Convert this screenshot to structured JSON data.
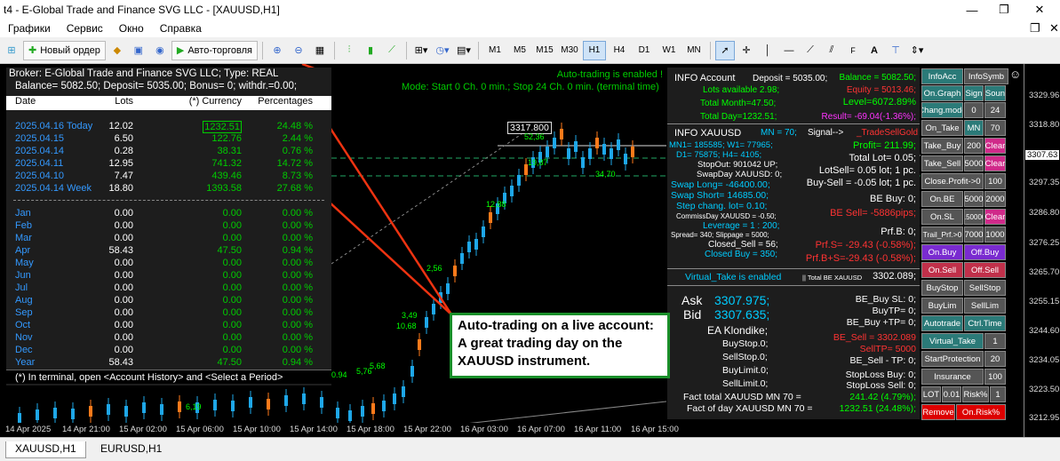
{
  "window": {
    "title": "t4 - E-Global Trade and Finance SVG LLC - [XAUUSD,H1]"
  },
  "menu": [
    "Графики",
    "Сервис",
    "Окно",
    "Справка"
  ],
  "toolbar": {
    "new_order": "Новый ордер",
    "autotrading": "Авто-торговля",
    "timeframes": [
      "M1",
      "M5",
      "M15",
      "M30",
      "H1",
      "H4",
      "D1",
      "W1",
      "MN"
    ],
    "selected_tf": "H1"
  },
  "left_panel": {
    "broker_line": "Broker:  E-Global Trade and Finance SVG LLC;   Type: REAL",
    "balance_line": "Balance= 5082.50; Deposit= 5035.00; Bonus= 0; withdr.=0.00;",
    "headers": {
      "date": "Date",
      "lots": "Lots",
      "currency": "(*)  Currency",
      "percent": "Percentages"
    },
    "days": [
      {
        "date": "2025.04.16 Today",
        "lots": "12.02",
        "currency": "1232.51",
        "percent": "24.48 %"
      },
      {
        "date": "2025.04.15",
        "lots": "6.50",
        "currency": "122.76",
        "percent": "2.44 %"
      },
      {
        "date": "2025.04.14",
        "lots": "0.28",
        "currency": "38.31",
        "percent": "0.76 %"
      },
      {
        "date": "2025.04.11",
        "lots": "12.95",
        "currency": "741.32",
        "percent": "14.72 %"
      },
      {
        "date": "2025.04.10",
        "lots": "7.47",
        "currency": "439.46",
        "percent": "8.73 %"
      },
      {
        "date": "2025.04.14 Week",
        "lots": "18.80",
        "currency": "1393.58",
        "percent": "27.68 %"
      }
    ],
    "months": [
      {
        "m": "Jan",
        "lots": "0.00",
        "currency": "0.00",
        "percent": "0.00 %"
      },
      {
        "m": "Feb",
        "lots": "0.00",
        "currency": "0.00",
        "percent": "0.00 %"
      },
      {
        "m": "Mar",
        "lots": "0.00",
        "currency": "0.00",
        "percent": "0.00 %"
      },
      {
        "m": "Apr",
        "lots": "58.43",
        "currency": "47.50",
        "percent": "0.94 %"
      },
      {
        "m": "May",
        "lots": "0.00",
        "currency": "0.00",
        "percent": "0.00 %"
      },
      {
        "m": "Jun",
        "lots": "0.00",
        "currency": "0.00",
        "percent": "0.00 %"
      },
      {
        "m": "Jul",
        "lots": "0.00",
        "currency": "0.00",
        "percent": "0.00 %"
      },
      {
        "m": "Aug",
        "lots": "0.00",
        "currency": "0.00",
        "percent": "0.00 %"
      },
      {
        "m": "Sep",
        "lots": "0.00",
        "currency": "0.00",
        "percent": "0.00 %"
      },
      {
        "m": "Oct",
        "lots": "0.00",
        "currency": "0.00",
        "percent": "0.00 %"
      },
      {
        "m": "Nov",
        "lots": "0.00",
        "currency": "0.00",
        "percent": "0.00 %"
      },
      {
        "m": "Dec",
        "lots": "0.00",
        "currency": "0.00",
        "percent": "0.00 %"
      },
      {
        "m": "Year",
        "lots": "58.43",
        "currency": "47.50",
        "percent": "0.94 %"
      }
    ],
    "footer": "(*) In terminal, open <Account History> and <Select a Period>"
  },
  "autotrading": {
    "enabled": "Auto-trading is enabled !",
    "mode": "Mode: Start  0 Ch. 0 min.;  Stop  24 Ch. 0 min. (terminal time)"
  },
  "chart": {
    "price_label": "3317.800",
    "current_price": "3307.63",
    "labels": [
      "52,36",
      "34,70",
      "19,87",
      "0.94",
      "3,49",
      "10,68",
      "5,76",
      "6,19",
      "5,68",
      "2,56",
      "12,88"
    ]
  },
  "info_account": {
    "title": "INFO Account",
    "deposit": "Deposit = 5035.00;",
    "balance": "Balance = 5082.50;",
    "lots_available": "Lots available 2.98;",
    "equity": "Equity = 5013.46;",
    "total_month": "Total Month=47.50;",
    "level": "Level=6072.89%",
    "total_day": "Total Day=1232.51;",
    "result": "Result= -69.04(-1.36%);"
  },
  "info_symbol": {
    "title": "INFO XAUUSD",
    "mn": "MN = 70;",
    "signal": "Signal-->",
    "ea": "_TradeSellGold",
    "l1": "MN1= 185585;  W1= 77965;",
    "l2": "D1= 75875;    H4= 4105;",
    "stopout": "StopOut: 901042 UP;",
    "swapday": "SwapDay XAUUSD:  0;",
    "swap_long": "Swap Long= -46400.00;",
    "swap_short": "Swap Short= 14685.00;",
    "step": "Step chang. lot= 0.10;",
    "commis": "CommissDay XAUUSD = -0.50;",
    "leverage": "Leverage = 1 : 200;",
    "spread": "Spread= 340; Slippage = 5000;",
    "closed_sell": "Closed_Sell = 56;",
    "closed_buy": "Closed Buy = 350;",
    "profit": "Profit= 211.99;",
    "total_lot": "Total Lot= 0.05;",
    "lotsell": "LotSell= 0.05 lot; 1 pc.",
    "buysell": "Buy-Sell = -0.05 lot; 1 pc.",
    "be_buy": "BE Buy: 0;",
    "be_sell": "BE Sell= -5886pips;",
    "prf_b": "Prf.B: 0;",
    "prf_s": "Prf.S= -29.43 (-0.58%);",
    "prf_bs": "Prf.B+S=-29.43 (-0.58%);",
    "virtual_take": "Virtual_Take is enabled",
    "total_be": "|| Total BE XAUUSD",
    "total_be_val": "3302.089;",
    "ask_label": "Ask",
    "ask": "3307.975;",
    "bid_label": "Bid",
    "bid": "3307.635;",
    "ea_name": "EA Klondike;",
    "buystop": "BuyStop.0;",
    "sellstop": "SellStop.0;",
    "buylimit": "BuyLimit.0;",
    "selllimit": "SellLimit.0;",
    "be_buy_sl": "BE_Buy SL: 0;",
    "buytp": "BuyTP= 0;",
    "be_buy_tp": "BE_Buy +TP= 0;",
    "be_sell2": "BE_Sell = 3302.089",
    "selltp": "SellTP= 5000",
    "be_sell_tp": "BE_Sell - TP: 0;",
    "stoploss_buy": "StopLoss Buy: 0;",
    "stoploss_sell": "StopLoss Sell: 0;",
    "fact_total_lbl": "Fact total     XAUUSD MN 70 =",
    "fact_total": "241.42 (4.79%);",
    "fact_day_lbl": "Fact of day XAUUSD MN 70 =",
    "fact_day": "1232.51 (24.48%);"
  },
  "buttons": [
    [
      "InfoAcc",
      "InfoSymb"
    ],
    [
      "On.Graph",
      "Sign",
      "Soun"
    ],
    [
      "Chang.mode",
      "0",
      "24"
    ],
    [
      "On_Take",
      "MN",
      "70"
    ],
    [
      "Take_Buy",
      "200",
      "Clear"
    ],
    [
      "Take_Sell",
      "5000",
      "Clear"
    ],
    [
      "Close.Profit->0",
      "100"
    ],
    [
      "On.BE",
      "5000",
      "2000"
    ],
    [
      "On.SL",
      "150000",
      "Clear"
    ],
    [
      "Trail_Prf.>0",
      "7000",
      "1000"
    ],
    [
      "On.Buy",
      "Off.Buy"
    ],
    [
      "On.Sell",
      "Off.Sell"
    ],
    [
      "BuyStop",
      "SellStop"
    ],
    [
      "BuyLim",
      "SellLim"
    ],
    [
      "Autotrade",
      "Ctrl.Time"
    ],
    [
      "Virtual_Take",
      "1"
    ],
    [
      "StartProtection",
      "20"
    ],
    [
      "Insurance",
      "100"
    ],
    [
      "LOT",
      "0.01",
      "Risk%",
      "1"
    ],
    [
      "Remove",
      "On.Risk%"
    ]
  ],
  "price_axis": [
    "3329.96",
    "3318.80",
    "3307.63",
    "3297.35",
    "3286.80",
    "3276.25",
    "3265.70",
    "3255.15",
    "3244.60",
    "3234.05",
    "3223.50",
    "3212.95"
  ],
  "time_axis": [
    "14 Apr 2025",
    "14 Apr 21:00",
    "15 Apr 02:00",
    "15 Apr 06:00",
    "15 Apr 10:00",
    "15 Apr 14:00",
    "15 Apr 18:00",
    "15 Apr 22:00",
    "16 Apr 03:00",
    "16 Apr 07:00",
    "16 Apr 11:00",
    "16 Apr 15:00"
  ],
  "callout": {
    "l1": "Auto-trading on a live account:",
    "l2": "A great trading day on the",
    "l3": "XAUUSD instrument."
  },
  "tabs": [
    "XAUUSD,H1",
    "EURUSD,H1"
  ]
}
